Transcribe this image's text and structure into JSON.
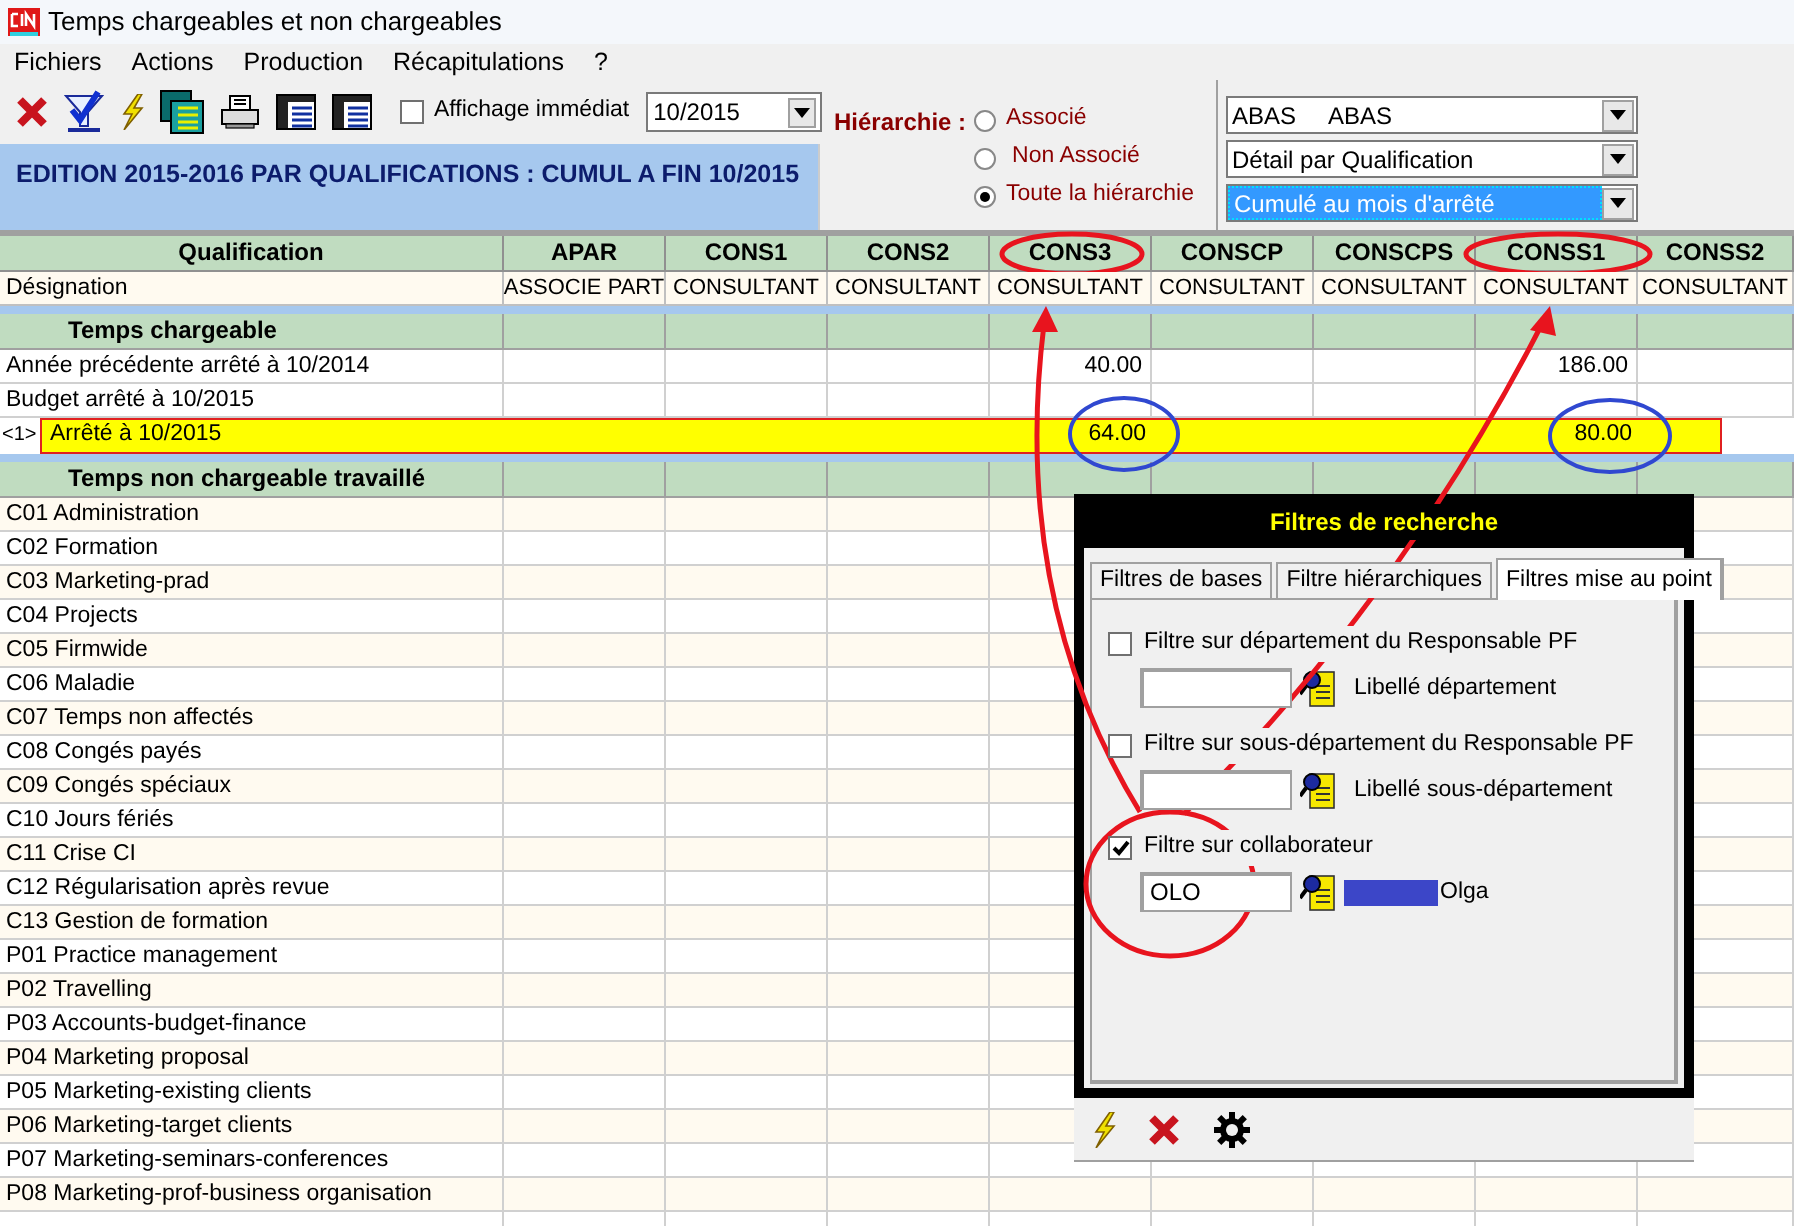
{
  "window": {
    "title": "Temps chargeables et non chargeables"
  },
  "menu": [
    "Fichiers",
    "Actions",
    "Production",
    "Récapitulations",
    "?"
  ],
  "toolbar": {
    "immediate_display": {
      "label": "Affichage immédiat",
      "checked": false
    },
    "period": {
      "value": "10/2015"
    }
  },
  "edition_title": "EDITION 2015-2016 PAR QUALIFICATIONS : CUMUL A FIN 10/2015",
  "hierarchy": {
    "label": "Hiérarchie :",
    "options": [
      {
        "label": "Associé",
        "selected": false
      },
      {
        "label": "Non Associé",
        "selected": false
      },
      {
        "label": "Toute la hiérarchie",
        "selected": true
      }
    ]
  },
  "dropdowns": [
    {
      "value": "ABAS     ABAS",
      "focused": false
    },
    {
      "value": "Détail par Qualification",
      "focused": false
    },
    {
      "value": "Cumulé au mois d'arrêté",
      "focused": true
    }
  ],
  "table": {
    "columns": [
      {
        "code": "Qualification",
        "designation": "Désignation"
      },
      {
        "code": "APAR",
        "designation": "ASSOCIE PART"
      },
      {
        "code": "CONS1",
        "designation": "CONSULTANT"
      },
      {
        "code": "CONS2",
        "designation": "CONSULTANT"
      },
      {
        "code": "CONS3",
        "designation": "CONSULTANT"
      },
      {
        "code": "CONSCP",
        "designation": "CONSULTANT"
      },
      {
        "code": "CONSCPS",
        "designation": "CONSULTANT"
      },
      {
        "code": "CONSS1",
        "designation": "CONSULTANT"
      },
      {
        "code": "CONSS2",
        "designation": "CONSULTANT"
      }
    ],
    "sections": [
      {
        "title": "Temps chargeable",
        "rows": [
          {
            "label": "Année précédente arrêté à 10/2014",
            "highlighted": false,
            "cells": [
              {
                "kind": "empty"
              },
              {
                "kind": "empty"
              },
              {
                "kind": "empty"
              },
              {
                "kind": "value",
                "text": "40.00"
              },
              {
                "kind": "empty"
              },
              {
                "kind": "empty"
              },
              {
                "kind": "value",
                "text": "186.00"
              },
              {
                "kind": "empty"
              }
            ]
          },
          {
            "label": "Budget arrêté à 10/2015",
            "highlighted": false
          },
          {
            "marker": "<1>",
            "label": "Arrêté à 10/2015",
            "highlighted": true,
            "cells": [
              {
                "kind": "empty"
              },
              {
                "kind": "empty"
              },
              {
                "kind": "empty"
              },
              {
                "kind": "value",
                "text": "64.00"
              },
              {
                "kind": "empty"
              },
              {
                "kind": "empty"
              },
              {
                "kind": "value",
                "text": "80.00"
              },
              {
                "kind": "empty"
              }
            ]
          }
        ]
      },
      {
        "title": "Temps non chargeable travaillé",
        "rows": [
          {
            "label": "C01 Administration",
            "highlighted": false
          },
          {
            "label": "C02 Formation",
            "highlighted": false
          },
          {
            "label": "C03 Marketing-prad",
            "highlighted": false
          },
          {
            "label": "C04 Projects",
            "highlighted": false
          },
          {
            "label": "C05 Firmwide",
            "highlighted": false
          },
          {
            "label": "C06 Maladie",
            "highlighted": false
          },
          {
            "label": "C07 Temps non affectés",
            "highlighted": false
          },
          {
            "label": "C08 Congés payés",
            "highlighted": false
          },
          {
            "label": "C09 Congés spéciaux",
            "highlighted": false
          },
          {
            "label": "C10 Jours fériés",
            "highlighted": false
          },
          {
            "label": "C11 Crise CI",
            "highlighted": false
          },
          {
            "label": "C12 Régularisation après revue",
            "highlighted": false
          },
          {
            "label": "C13 Gestion de formation",
            "highlighted": false
          },
          {
            "label": "P01 Practice management",
            "highlighted": false
          },
          {
            "label": "P02 Travelling",
            "highlighted": false
          },
          {
            "label": "P03 Accounts-budget-finance",
            "highlighted": false
          },
          {
            "label": "P04 Marketing proposal",
            "highlighted": false
          },
          {
            "label": "P05 Marketing-existing clients",
            "highlighted": false
          },
          {
            "label": "P06 Marketing-target clients",
            "highlighted": false
          },
          {
            "label": "P07 Marketing-seminars-conferences",
            "highlighted": false
          },
          {
            "label": "P08 Marketing-prof-business organisation",
            "highlighted": false
          }
        ]
      }
    ]
  },
  "dialog": {
    "title": "Filtres de recherche",
    "tabs": [
      {
        "label": "Filtres de bases",
        "selected": false
      },
      {
        "label": "Filtre hiérarchiques",
        "selected": false
      },
      {
        "label": "Filtres mise au point",
        "selected": true
      }
    ],
    "filters": [
      {
        "label": "Filtre sur département du Responsable PF",
        "checked": false,
        "description": "Libellé département",
        "description_selected": false
      },
      {
        "label": "Filtre sur sous-département du Responsable PF",
        "checked": false,
        "description": "Libellé sous-département",
        "description_selected": false
      },
      {
        "label": "Filtre sur collaborateur",
        "checked": true,
        "value": "OLO",
        "description": "Olga",
        "description_selected": true
      }
    ]
  }
}
